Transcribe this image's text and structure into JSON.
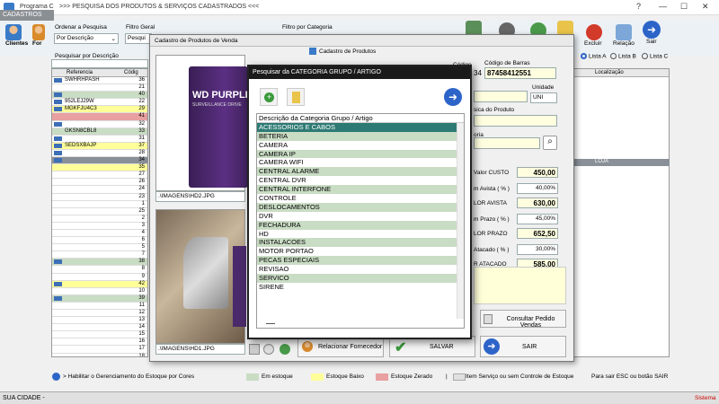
{
  "window": {
    "title": "Programa C",
    "app_title": ">>>  PESQUISA DOS PRODUTOS & SERVIÇOS CADASTRADOS  <<<",
    "menu": "CADASTROS",
    "help": "?",
    "min": "—",
    "max": "☐",
    "close": "✕"
  },
  "toolbar": {
    "clientes": "Clientes",
    "fornecedores": "For",
    "order_label": "Ordenar a Pesquisa",
    "order_value": "Por Descrição",
    "filter_label": "Filtro Geral",
    "filter_value": "Pesqui",
    "category_filter_label": "Filtro por Categoria",
    "excluir": "Excluir",
    "relacao": "Relação",
    "sair": "Sair",
    "lista_a": "Lista A",
    "lista_b": "Lista B",
    "lista_c": "Lista C"
  },
  "search": {
    "label": "Pesquisar por Descrição"
  },
  "grid": {
    "headers": [
      "Referencia",
      "Códig"
    ],
    "rows": [
      {
        "ref": "SWHRHPASH",
        "cod": "36",
        "color": "#ffffff",
        "mark": true
      },
      {
        "ref": "",
        "cod": "21",
        "color": "#ffffff",
        "mark": false
      },
      {
        "ref": "",
        "cod": "40",
        "color": "#c9dcc4",
        "mark": true
      },
      {
        "ref": "952LEJ29W",
        "cod": "22",
        "color": "#ffffff",
        "mark": true
      },
      {
        "ref": "MGKFJU4C3",
        "cod": "29",
        "color": "#ffff99",
        "mark": true
      },
      {
        "ref": "",
        "cod": "41",
        "color": "#e8a0a0",
        "mark": false
      },
      {
        "ref": "",
        "cod": "32",
        "color": "#ffffff",
        "mark": true
      },
      {
        "ref": "GKSN8CBL8",
        "cod": "33",
        "color": "#c9dcc4",
        "mark": false
      },
      {
        "ref": "",
        "cod": "31",
        "color": "#ffffff",
        "mark": true
      },
      {
        "ref": "SEDSXBAJP",
        "cod": "37",
        "color": "#ffff99",
        "mark": true
      },
      {
        "ref": "",
        "cod": "28",
        "color": "#ffffff",
        "mark": true
      },
      {
        "ref": "",
        "cod": "34",
        "color": "#8a9098",
        "mark": true
      },
      {
        "ref": "",
        "cod": "35",
        "color": "#ffff99",
        "mark": false
      },
      {
        "ref": "",
        "cod": "27",
        "color": "#ffffff",
        "mark": false
      },
      {
        "ref": "",
        "cod": "26",
        "color": "#ffffff",
        "mark": false
      },
      {
        "ref": "",
        "cod": "24",
        "color": "#ffffff",
        "mark": false
      },
      {
        "ref": "",
        "cod": "23",
        "color": "#ffffff",
        "mark": false
      },
      {
        "ref": "",
        "cod": "1",
        "color": "#ffffff",
        "mark": false
      },
      {
        "ref": "",
        "cod": "25",
        "color": "#ffffff",
        "mark": false
      },
      {
        "ref": "",
        "cod": "2",
        "color": "#ffffff",
        "mark": false
      },
      {
        "ref": "",
        "cod": "3",
        "color": "#ffffff",
        "mark": false
      },
      {
        "ref": "",
        "cod": "4",
        "color": "#ffffff",
        "mark": false
      },
      {
        "ref": "",
        "cod": "6",
        "color": "#ffffff",
        "mark": false
      },
      {
        "ref": "",
        "cod": "5",
        "color": "#ffffff",
        "mark": false
      },
      {
        "ref": "",
        "cod": "7",
        "color": "#ffffff",
        "mark": false
      },
      {
        "ref": "",
        "cod": "38",
        "color": "#c9dcc4",
        "mark": true
      },
      {
        "ref": "",
        "cod": "8",
        "color": "#ffffff",
        "mark": false
      },
      {
        "ref": "",
        "cod": "9",
        "color": "#ffffff",
        "mark": false
      },
      {
        "ref": "",
        "cod": "42",
        "color": "#ffff99",
        "mark": true
      },
      {
        "ref": "",
        "cod": "10",
        "color": "#ffffff",
        "mark": false
      },
      {
        "ref": "",
        "cod": "39",
        "color": "#c9dcc4",
        "mark": true
      },
      {
        "ref": "",
        "cod": "11",
        "color": "#ffffff",
        "mark": false
      },
      {
        "ref": "",
        "cod": "12",
        "color": "#ffffff",
        "mark": false
      },
      {
        "ref": "",
        "cod": "13",
        "color": "#ffffff",
        "mark": false
      },
      {
        "ref": "",
        "cod": "14",
        "color": "#ffffff",
        "mark": false
      },
      {
        "ref": "",
        "cod": "15",
        "color": "#ffffff",
        "mark": false
      },
      {
        "ref": "",
        "cod": "16",
        "color": "#ffffff",
        "mark": false
      },
      {
        "ref": "",
        "cod": "17",
        "color": "#ffffff",
        "mark": false
      },
      {
        "ref": "",
        "cod": "18",
        "color": "#ffffff",
        "mark": false
      }
    ]
  },
  "right_grid": {
    "header": "Localização",
    "loja": "LOJA"
  },
  "cadastro": {
    "title": "Cadastro de Produtos de Venda",
    "window_label": "Cadastro de Produtos",
    "codigo_label": "Código",
    "codigo_value": "34",
    "barcode_label": "Código de Barras",
    "barcode_value": "87458412551",
    "unidade_label": "Unidade",
    "unidade_value": "UNI",
    "desc_label": "sica do Produto",
    "categoria_label": "oria",
    "image1_path": ".\\IMAGENS\\HD2.JPG",
    "image2_path": ".\\IMAGENS\\HD1.JPG",
    "product_brand": "WD PURPLE",
    "product_sub": "SURVEILLANCE DRIVE",
    "valor_custo_label": "Valor CUSTO",
    "valor_custo": "450,00",
    "margem_vista_label": "m Avista ( % )",
    "margem_vista": "40,00%",
    "valor_vista_label": "LOR AVISTA",
    "valor_vista": "630,00",
    "margem_prazo_label": "m Prazo ( % )",
    "margem_prazo": "45,00%",
    "valor_prazo_label": "LOR PRAZO",
    "valor_prazo": "652,50",
    "margem_atacado_label": "Atacado ( % )",
    "margem_atacado": "30,00%",
    "valor_atacado_label": "R ATACADO",
    "valor_atacado": "585,00",
    "consultar_label": "Consultar Pedido Vendas",
    "relacionar_label": "Relacionar Fornecedor",
    "salvar_label": "SALVAR",
    "sair_label": "SAIR"
  },
  "category_dialog": {
    "title": "Pesquisar da CATEGORIA GRUPO / ARTIGO",
    "header": "Descrição da Categoria Grupo / Artigo",
    "items": [
      "ACESSORIOS E CABOS",
      "BETERIA",
      "CAMERA",
      "CAMERA IP",
      "CAMERA WIFI",
      "CENTRAL ALARME",
      "CENTRAL DVR",
      "CENTRAL INTERFONE",
      "CONTROLE",
      "DESLOCAMENTOS",
      "DVR",
      "FECHADURA",
      "HD",
      "INSTALACOES",
      "MOTOR PORTAO",
      "PECAS ESPECIAIS",
      "REVISAO",
      "SERVICO",
      "SIRENE"
    ],
    "selected_index": 0
  },
  "legend": {
    "habilitar": "> Habilitar o Gerenciamento do Estoque por Cores",
    "em_estoque": "Em estoque",
    "estoque_baixo": "Estoque Baixo",
    "estoque_zerado": "Estoque Zerado",
    "servico": "Item Serviço ou sem Controle de Estoque",
    "sair_hint": "Para sair ESC ou botão SAIR",
    "sep": "|"
  },
  "status": {
    "city": "SUA CIDADE -",
    "sistema": "Sistema"
  },
  "colors": {
    "em_estoque": "#c9dcc4",
    "estoque_baixo": "#ffff99",
    "estoque_zerado": "#e8a0a0",
    "servico": "#e0e0e0",
    "accent": "#2d7a74"
  }
}
